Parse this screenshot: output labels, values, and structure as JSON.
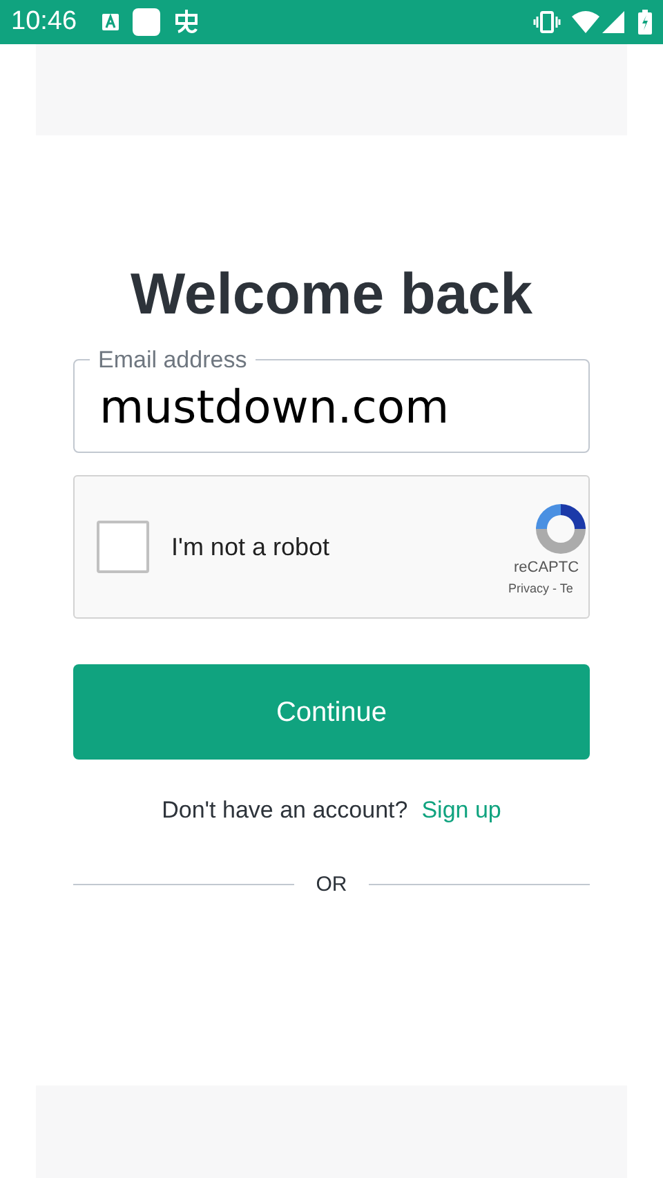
{
  "status_bar": {
    "time": "10:46"
  },
  "title": "Welcome back",
  "email": {
    "label": "Email address",
    "value": "mustdown.com"
  },
  "captcha": {
    "label": "I'm not a robot",
    "checked": false,
    "brand": "reCAPTC",
    "links": "Privacy - Te"
  },
  "continue_button": "Continue",
  "signup": {
    "prompt": "Don't have an account?",
    "link": "Sign up"
  },
  "divider": "OR"
}
